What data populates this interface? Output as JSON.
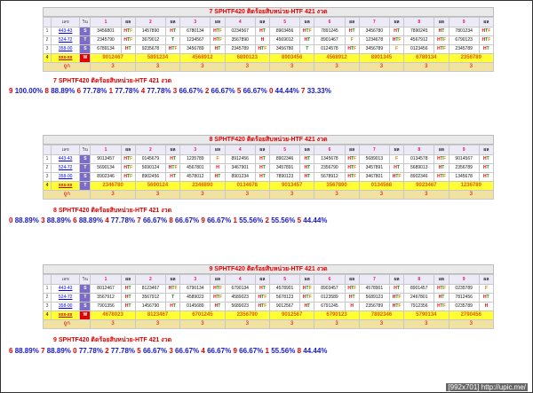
{
  "watermark": "[992x701] http://upic.me/",
  "tables": [
    {
      "title": "7 SPHTF420 ติดร้อยสิบหน่วย-HTF 421 งวด",
      "header": {
        "col0": "",
        "col1": "เลข",
        "col2": "วิน",
        "nums": [
          "1",
          "2",
          "3",
          "4",
          "5",
          "6",
          "7",
          "8",
          "9"
        ],
        "pl": "ผล"
      },
      "rows": [
        {
          "idx": "1",
          "code": "443-43",
          "box": "S",
          "box_color": "#7b6cc8",
          "cells": [
            [
              "3456801",
              "HTF"
            ],
            [
              "1457890",
              "HT"
            ],
            [
              "6780134",
              "HTF"
            ],
            [
              "0234567",
              "HT"
            ],
            [
              "8903456",
              "HTF"
            ],
            [
              "7891245",
              "HT"
            ],
            [
              "3456780",
              "HT"
            ],
            [
              "7890245",
              "HT"
            ],
            [
              "7801234",
              "HTF"
            ]
          ]
        },
        {
          "idx": "2",
          "code": "524-72",
          "box": "T",
          "box_color": "#7b6cc8",
          "cells": [
            [
              "2345790",
              "HTF"
            ],
            [
              "3679012",
              "T"
            ],
            [
              "1234567",
              "HTF"
            ],
            [
              "3567890",
              "H"
            ],
            [
              "4569012",
              "HT"
            ],
            [
              "8901467",
              "F"
            ],
            [
              "1234678",
              "HTF"
            ],
            [
              "4567912",
              "HTF"
            ],
            [
              "6790123",
              "HTF"
            ]
          ]
        },
        {
          "idx": "3",
          "code": "358-00",
          "box": "S",
          "box_color": "#7b6cc8",
          "cells": [
            [
              "6789134",
              "HT"
            ],
            [
              "9235678",
              "HTF"
            ],
            [
              "3456789",
              "HT"
            ],
            [
              "2345789",
              "HTF"
            ],
            [
              "3456780",
              "T"
            ],
            [
              "0124578",
              "HTF"
            ],
            [
              "3456789",
              "F"
            ],
            [
              "0123456",
              "HTF"
            ],
            [
              "2345789",
              "HT"
            ]
          ]
        }
      ],
      "yellow": {
        "idx": "4",
        "code": "xxx-xx",
        "box": "W",
        "values": [
          "9012467",
          "5891234",
          "4568912",
          "6890123",
          "8903456",
          "4568912",
          "8901345",
          "6789134",
          "2356789"
        ]
      },
      "count_row": {
        "label": "ถูก",
        "values": [
          "3",
          "3",
          "3",
          "3",
          "3",
          "3",
          "3",
          "3",
          "3"
        ]
      },
      "subtitle": "7 SPHTF420 ติดร้อยสิบหน่วย-HTF 421 งวด",
      "stats": [
        [
          "9",
          "100.00%"
        ],
        [
          "8",
          "88.89%"
        ],
        [
          "6",
          "77.78%"
        ],
        [
          "1",
          "77.78%"
        ],
        [
          "4",
          "77.78%"
        ],
        [
          "3",
          "66.67%"
        ],
        [
          "2",
          "66.67%"
        ],
        [
          "5",
          "66.67%"
        ],
        [
          "0",
          "44.44%"
        ],
        [
          "7",
          "33.33%"
        ]
      ]
    },
    {
      "title": "8 SPHTF420 ติดร้อยสิบหน่วย-HTF 421 งวด",
      "header": {
        "col0": "",
        "col1": "เลข",
        "col2": "วิน",
        "nums": [
          "1",
          "2",
          "3",
          "4",
          "5",
          "6",
          "7",
          "8",
          "9"
        ],
        "pl": "ผล"
      },
      "rows": [
        {
          "idx": "1",
          "code": "443-43",
          "box": "S",
          "box_color": "#7b6cc8",
          "cells": [
            [
              "9013457",
              "HTF"
            ],
            [
              "0145679",
              "HT"
            ],
            [
              "1235789",
              "F"
            ],
            [
              "8912456",
              "HT"
            ],
            [
              "8902346",
              "HT"
            ],
            [
              "1345678",
              "HTF"
            ],
            [
              "5689013",
              "F"
            ],
            [
              "0134578",
              "HTF"
            ],
            [
              "9014567",
              "HT"
            ]
          ]
        },
        {
          "idx": "2",
          "code": "524-72",
          "box": "T",
          "box_color": "#7b6cc8",
          "cells": [
            [
              "5690134",
              "HTF"
            ],
            [
              "5690124",
              "HTF"
            ],
            [
              "4567801",
              "H"
            ],
            [
              "3467901",
              "HT"
            ],
            [
              "3457891",
              "HT"
            ],
            [
              "2356790",
              "HTF"
            ],
            [
              "3457891",
              "HT"
            ],
            [
              "5689013",
              "HT"
            ],
            [
              "2356789",
              "HT"
            ]
          ]
        },
        {
          "idx": "3",
          "code": "358-00",
          "box": "S",
          "box_color": "#7b6cc8",
          "cells": [
            [
              "8902346",
              "HTF"
            ],
            [
              "8902456",
              "HT"
            ],
            [
              "4578012",
              "HT"
            ],
            [
              "8901234",
              "HT"
            ],
            [
              "7890123",
              "HT"
            ],
            [
              "5678912",
              "HTF"
            ],
            [
              "3467801",
              "HTF"
            ],
            [
              "8902346",
              "HTF"
            ],
            [
              "1345678",
              "HT"
            ]
          ]
        }
      ],
      "yellow": {
        "idx": "4",
        "code": "xxx-xx",
        "box": "T",
        "values": [
          "2346780",
          "5690124",
          "2346890",
          "0134678",
          "9013457",
          "3567890",
          "0134568",
          "9023467",
          "1236789"
        ]
      },
      "count_row": {
        "label": "ถูก",
        "values": [
          "3",
          "3",
          "3",
          "3",
          "3",
          "3",
          "3",
          "3",
          "3"
        ]
      },
      "subtitle": "8 SPHTF420 ติดร้อยสิบหน่วย-HTF 421 งวด",
      "stats": [
        [
          "0",
          "88.89%"
        ],
        [
          "3",
          "88.89%"
        ],
        [
          "6",
          "88.89%"
        ],
        [
          "4",
          "77.78%"
        ],
        [
          "7",
          "66.67%"
        ],
        [
          "8",
          "66.67%"
        ],
        [
          "9",
          "66.67%"
        ],
        [
          "1",
          "55.56%"
        ],
        [
          "2",
          "55.56%"
        ],
        [
          "5",
          "44.44%"
        ]
      ]
    },
    {
      "title": "9 SPHTF420 ติดร้อยสิบหน่วย-HTF 421 งวด",
      "header": {
        "col0": "",
        "col1": "เลข",
        "col2": "วิน",
        "nums": [
          "1",
          "2",
          "3",
          "4",
          "5",
          "6",
          "7",
          "8",
          "9"
        ],
        "pl": "ผล"
      },
      "rows": [
        {
          "idx": "1",
          "code": "443-43",
          "box": "S",
          "box_color": "#7b6cc8",
          "cells": [
            [
              "8012467",
              "HT"
            ],
            [
              "8123467",
              "HTF"
            ],
            [
              "6790134",
              "HTF"
            ],
            [
              "6790134",
              "HT"
            ],
            [
              "4578901",
              "HTF"
            ],
            [
              "8903457",
              "HTF"
            ],
            [
              "4578901",
              "HT"
            ],
            [
              "8901457",
              "HTF"
            ],
            [
              "0235789",
              "F"
            ]
          ]
        },
        {
          "idx": "2",
          "code": "524-72",
          "box": "T",
          "box_color": "#7b6cc8",
          "cells": [
            [
              "3567912",
              "HT"
            ],
            [
              "3567912",
              "T"
            ],
            [
              "4589023",
              "HTF"
            ],
            [
              "4589023",
              "HTF"
            ],
            [
              "5678123",
              "HTF"
            ],
            [
              "0123589",
              "HT"
            ],
            [
              "5689123",
              "HTF"
            ],
            [
              "2467801",
              "HT"
            ],
            [
              "7812456",
              "HT"
            ]
          ]
        },
        {
          "idx": "3",
          "code": "358-00",
          "box": "S",
          "box_color": "#7b6cc8",
          "cells": [
            [
              "7901356",
              "HT"
            ],
            [
              "1456790",
              "HT"
            ],
            [
              "0145689",
              "HT"
            ],
            [
              "5689023",
              "HTF"
            ],
            [
              "9012567",
              "HT"
            ],
            [
              "6791245",
              "H"
            ],
            [
              "2356789",
              "HTF"
            ],
            [
              "7912356",
              "HTF"
            ],
            [
              "0235789",
              "H"
            ]
          ]
        }
      ],
      "yellow": {
        "idx": "4",
        "code": "xxx-xx",
        "box": "W",
        "values": [
          "4678023",
          "8123467",
          "6701245",
          "2356790",
          "9012567",
          "6790123",
          "7892346",
          "5790134",
          "2790456"
        ]
      },
      "count_row": {
        "label": "ถูก",
        "values": [
          "3",
          "3",
          "3",
          "3",
          "3",
          "3",
          "3",
          "3",
          "3"
        ]
      },
      "subtitle": "9 SPHTF420 ติดร้อยสิบหน่วย-HTF 421 งวด",
      "stats": [
        [
          "6",
          "88.89%"
        ],
        [
          "7",
          "88.89%"
        ],
        [
          "0",
          "77.78%"
        ],
        [
          "2",
          "77.78%"
        ],
        [
          "5",
          "66.67%"
        ],
        [
          "3",
          "66.67%"
        ],
        [
          "4",
          "66.67%"
        ],
        [
          "9",
          "66.67%"
        ],
        [
          "1",
          "55.56%"
        ],
        [
          "8",
          "44.44%"
        ]
      ]
    }
  ],
  "colors": {
    "box_S": "#7b6cc8",
    "box_T": "#7b6cc8",
    "box_W": "#e00000",
    "H": "#e00000",
    "T": "#0a8a0a",
    "F": "#e08000"
  }
}
